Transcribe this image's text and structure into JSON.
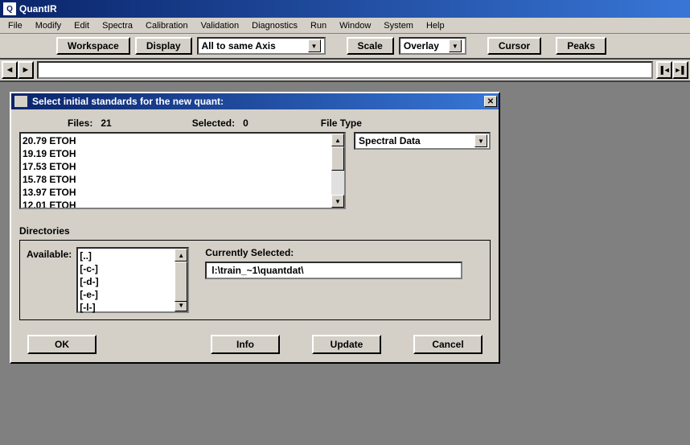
{
  "window": {
    "title": "QuantIR"
  },
  "menu": {
    "items": [
      "File",
      "Modify",
      "Edit",
      "Spectra",
      "Calibration",
      "Validation",
      "Diagnostics",
      "Run",
      "Window",
      "System",
      "Help"
    ]
  },
  "toolbar": {
    "workspace": "Workspace",
    "display": "Display",
    "axis_select": "All to same Axis",
    "scale": "Scale",
    "overlay": "Overlay",
    "cursor": "Cursor",
    "peaks": "Peaks"
  },
  "dialog": {
    "title": "Select initial standards for the new quant:",
    "files_label": "Files:",
    "files_count": "21",
    "selected_label": "Selected:",
    "selected_count": "0",
    "filetype_label": "File Type",
    "filetype_value": "Spectral Data",
    "files": [
      "20.79 ETOH",
      "19.19 ETOH",
      "17.53 ETOH",
      "15.78 ETOH",
      "13.97 ETOH",
      "12.01 ETOH"
    ],
    "directories_label": "Directories",
    "available_label": "Available:",
    "dirs": [
      "[..]",
      "[-c-]",
      "[-d-]",
      "[-e-]",
      "[-l-]"
    ],
    "currently_selected_label": "Currently Selected:",
    "current_path": "l:\\train_~1\\quantdat\\",
    "buttons": {
      "ok": "OK",
      "info": "Info",
      "update": "Update",
      "cancel": "Cancel"
    }
  }
}
